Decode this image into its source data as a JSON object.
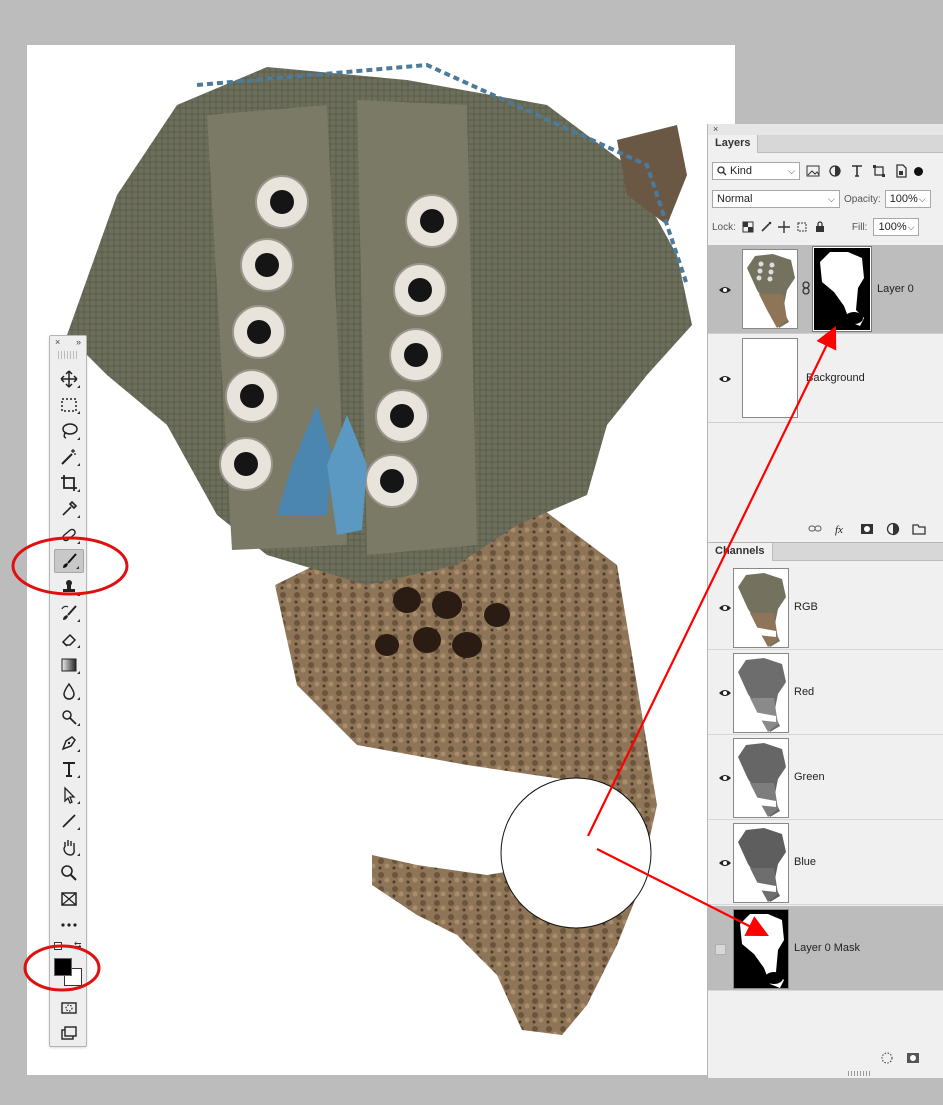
{
  "toolbox": {
    "close_glyph": "×",
    "collapse_glyph": "»",
    "tools": [
      {
        "name": "move-tool",
        "icon": "move-icon"
      },
      {
        "name": "marquee-tool",
        "icon": "marquee-icon"
      },
      {
        "name": "lasso-tool",
        "icon": "lasso-icon"
      },
      {
        "name": "magic-wand-tool",
        "icon": "magic-wand-icon"
      },
      {
        "name": "crop-tool",
        "icon": "crop-icon"
      },
      {
        "name": "eyedropper-tool",
        "icon": "eyedropper-icon"
      },
      {
        "name": "healing-brush-tool",
        "icon": "bandage-icon"
      },
      {
        "name": "brush-tool",
        "icon": "brush-icon",
        "active": true
      },
      {
        "name": "clone-stamp-tool",
        "icon": "stamp-icon"
      },
      {
        "name": "history-brush-tool",
        "icon": "history-brush-icon"
      },
      {
        "name": "eraser-tool",
        "icon": "eraser-icon"
      },
      {
        "name": "gradient-tool",
        "icon": "gradient-icon"
      },
      {
        "name": "blur-tool",
        "icon": "drop-icon"
      },
      {
        "name": "dodge-tool",
        "icon": "dodge-icon"
      },
      {
        "name": "pen-tool",
        "icon": "pen-icon"
      },
      {
        "name": "type-tool",
        "icon": "type-icon"
      },
      {
        "name": "path-selection-tool",
        "icon": "arrow-icon"
      },
      {
        "name": "line-tool",
        "icon": "line-icon"
      },
      {
        "name": "hand-tool",
        "icon": "hand-icon"
      },
      {
        "name": "zoom-tool",
        "icon": "zoom-icon"
      },
      {
        "name": "frame-tool",
        "icon": "frame-icon"
      },
      {
        "name": "more-tools",
        "icon": "ellipsis-icon"
      }
    ],
    "foreground_color": "#000000",
    "background_color": "#ffffff"
  },
  "layers_panel": {
    "tab_label": "Layers",
    "kind_label": "Kind",
    "blend_mode": "Normal",
    "opacity_label": "Opacity:",
    "opacity_value": "100%",
    "lock_label": "Lock:",
    "fill_label": "Fill:",
    "fill_value": "100%",
    "layers": [
      {
        "name": "Layer 0",
        "selected": true,
        "visible": true,
        "has_mask": true
      },
      {
        "name": "Background",
        "selected": false,
        "visible": true,
        "has_mask": false
      }
    ]
  },
  "channels_panel": {
    "tab_label": "Channels",
    "channels": [
      {
        "name": "RGB",
        "visible": true,
        "selected": false
      },
      {
        "name": "Red",
        "visible": true,
        "selected": false
      },
      {
        "name": "Green",
        "visible": true,
        "selected": false
      },
      {
        "name": "Blue",
        "visible": true,
        "selected": false
      },
      {
        "name": "Layer 0 Mask",
        "visible": false,
        "selected": true
      }
    ]
  },
  "annotations": {
    "highlight_color": "#e01010",
    "arrow_color": "#ff0000"
  }
}
